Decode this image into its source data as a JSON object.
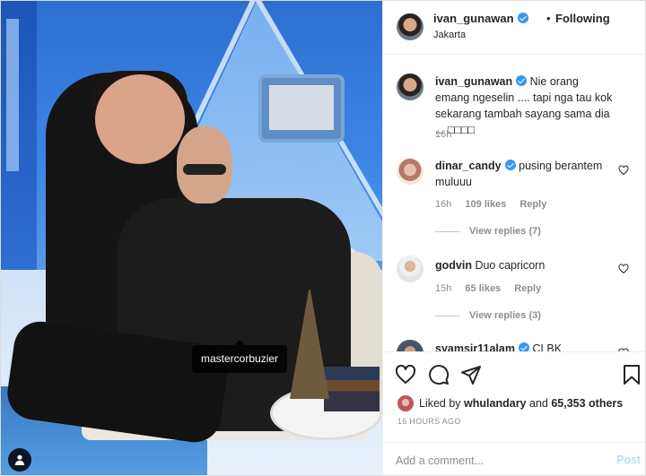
{
  "post": {
    "photo_tag": "mastercorbuzier",
    "header": {
      "username": "ivan_gunawan",
      "dot": "•",
      "follow_status": "Following",
      "location": "Jakarta"
    },
    "caption": {
      "username": "ivan_gunawan",
      "text": "Nie orang emang ngeselin .... tapi nga tau kok sekarang tambah sayang sama dia ... □□□□",
      "time": "16h"
    },
    "comments": [
      {
        "username": "dinar_candy",
        "verified": true,
        "text": "pusing berantem muluuu",
        "time": "16h",
        "likes": "109 likes",
        "reply": "Reply",
        "view_replies": "View replies (7)"
      },
      {
        "username": "godvin",
        "verified": false,
        "text": "Duo capricorn",
        "time": "15h",
        "likes": "65 likes",
        "reply": "Reply",
        "view_replies": "View replies (3)"
      },
      {
        "username": "syamsir11alam",
        "verified": true,
        "text": "CLBK"
      }
    ],
    "liked_by": {
      "prefix": "Liked by",
      "user": "whulandary",
      "connector": "and",
      "count": "65,353 others"
    },
    "time_ago": "16 HOURS AGO",
    "comment_box": {
      "placeholder": "Add a comment...",
      "post_label": "Post"
    }
  },
  "colors": {
    "verified": "#3897f0",
    "post_button_disabled": "#b2dffc",
    "secondary_text": "#8e8e8e"
  },
  "icons": [
    "heart-icon",
    "comment-icon",
    "share-icon",
    "bookmark-icon",
    "user-tag-icon",
    "verified-icon"
  ]
}
